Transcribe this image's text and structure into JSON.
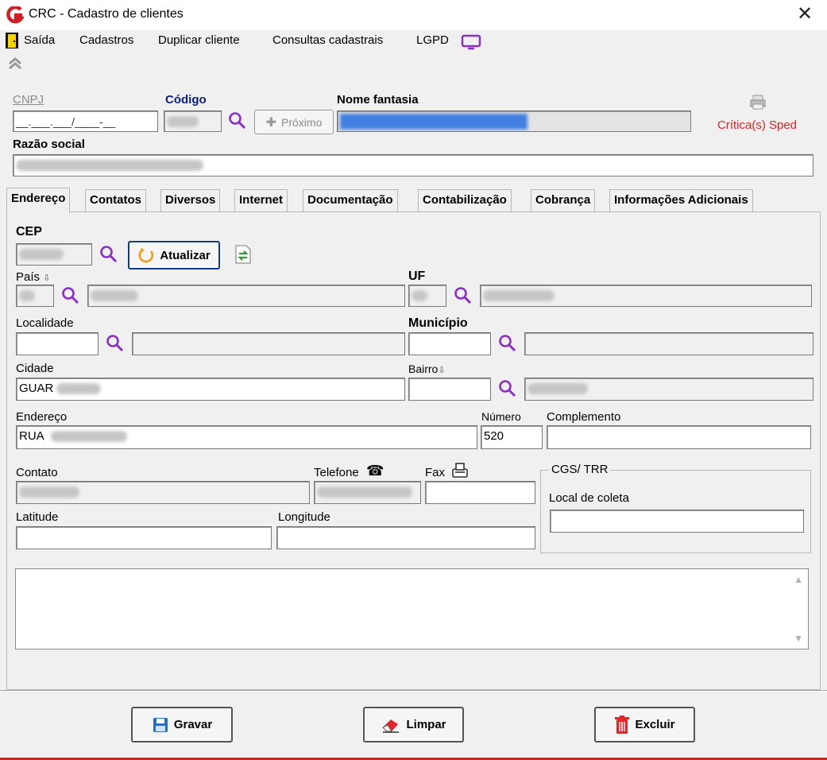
{
  "window": {
    "title": "CRC - Cadastro de clientes",
    "close_glyph": "✕"
  },
  "menu": {
    "items": [
      "Saída",
      "Cadastros",
      "Duplicar cliente",
      "Consultas cadastrais",
      "LGPD"
    ]
  },
  "header": {
    "cnpj_label": "CNPJ",
    "cnpj_mask": "__.___.___/____-__",
    "codigo_label": "Código",
    "proximo_label": "Próximo",
    "nome_fantasia_label": "Nome fantasia",
    "criticas_label": "Crítica(s) Sped",
    "razao_social_label": "Razão social"
  },
  "tabs": [
    "Endereço",
    "Contatos",
    "Diversos",
    "Internet",
    "Documentação",
    "Contabilização",
    "Cobrança",
    "Informações Adicionais"
  ],
  "address": {
    "cep_label": "CEP",
    "atualizar_label": "Atualizar",
    "pais_label": "País",
    "uf_label": "UF",
    "localidade_label": "Localidade",
    "municipio_label": "Município",
    "cidade_label": "Cidade",
    "cidade_value": "GUAR",
    "bairro_label": "Bairro",
    "endereco_label": "Endereço",
    "endereco_value": "RUA",
    "numero_label": "Número",
    "numero_value": "520",
    "complemento_label": "Complemento",
    "contato_label": "Contato",
    "telefone_label": "Telefone",
    "fax_label": "Fax",
    "latitude_label": "Latitude",
    "longitude_label": "Longitude",
    "group_title": "CGS/ TRR",
    "local_coleta_label": "Local de coleta"
  },
  "footer": {
    "gravar_label": "Gravar",
    "limpar_label": "Limpar",
    "excluir_label": "Excluir"
  },
  "colors": {
    "accent_purple": "#8b2fc9",
    "critica_red": "#e02020",
    "codigo_blue": "#0a1e7c"
  }
}
